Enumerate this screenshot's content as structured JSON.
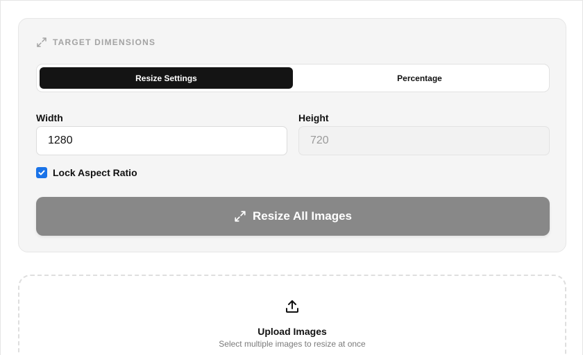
{
  "section": {
    "title": "TARGET DIMENSIONS",
    "icon": "expand-icon"
  },
  "tabs": [
    {
      "label": "Resize Settings",
      "active": true
    },
    {
      "label": "Percentage",
      "active": false
    }
  ],
  "width_field": {
    "label": "Width",
    "value": "1280"
  },
  "height_field": {
    "label": "Height",
    "value": "720"
  },
  "lock_aspect": {
    "label": "Lock Aspect Ratio",
    "checked": true
  },
  "resize_button": {
    "label": "Resize All Images",
    "icon": "expand-icon"
  },
  "upload": {
    "icon": "upload-icon",
    "title": "Upload Images",
    "subtitle": "Select multiple images to resize at once"
  },
  "colors": {
    "active_tab": "#141414",
    "checkbox": "#1a73e8",
    "button": "#888888"
  }
}
